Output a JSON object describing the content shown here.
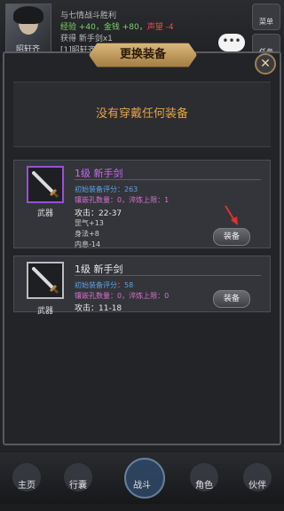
{
  "top": {
    "player_name": "昭轩齐",
    "log_line1": "与七情战斗胜利",
    "log_exp": "经验 +40，",
    "log_gold": "金钱 +80，",
    "log_reputation": "声望 -4",
    "log_line3": "获得 新手剑x1",
    "log_line4": "[1]昭轩齐",
    "menu_label": "菜单",
    "task_label": "任务",
    "chat_icon": "ellipsis-bubble-icon"
  },
  "dialog": {
    "title": "更换装备",
    "close_icon": "close-icon",
    "current_empty_text": "没有穿戴任何装备"
  },
  "items": [
    {
      "name": "1级 新手剑",
      "type_label": "武器",
      "icon": "sword-icon",
      "rating": "初始装备评分：263",
      "slots": "镶嵌孔数量：0，淬炼上限：1",
      "attack": "攻击：22-37",
      "stat2": "罡气+13",
      "stat3": "身法+8",
      "stat4": "内息-14",
      "equip_label": "装备"
    },
    {
      "name": "1级 新手剑",
      "type_label": "武器",
      "icon": "sword-icon",
      "rating": "初始装备评分：58",
      "slots": "镶嵌孔数量：0，淬炼上限：0",
      "attack": "攻击：11-18",
      "equip_label": "装备"
    }
  ],
  "nav": [
    {
      "label": "主页",
      "icon": "home-icon"
    },
    {
      "label": "行囊",
      "icon": "bag-icon"
    },
    {
      "label": "战斗",
      "icon": "battle-icon"
    },
    {
      "label": "角色",
      "icon": "character-icon"
    },
    {
      "label": "伙伴",
      "icon": "partner-icon"
    }
  ],
  "colors": {
    "accent_orange": "#e2a24a",
    "purple_rarity": "#c06cf0",
    "stat_blue": "#5aa2e8",
    "stat_magenta": "#d56fd0"
  }
}
